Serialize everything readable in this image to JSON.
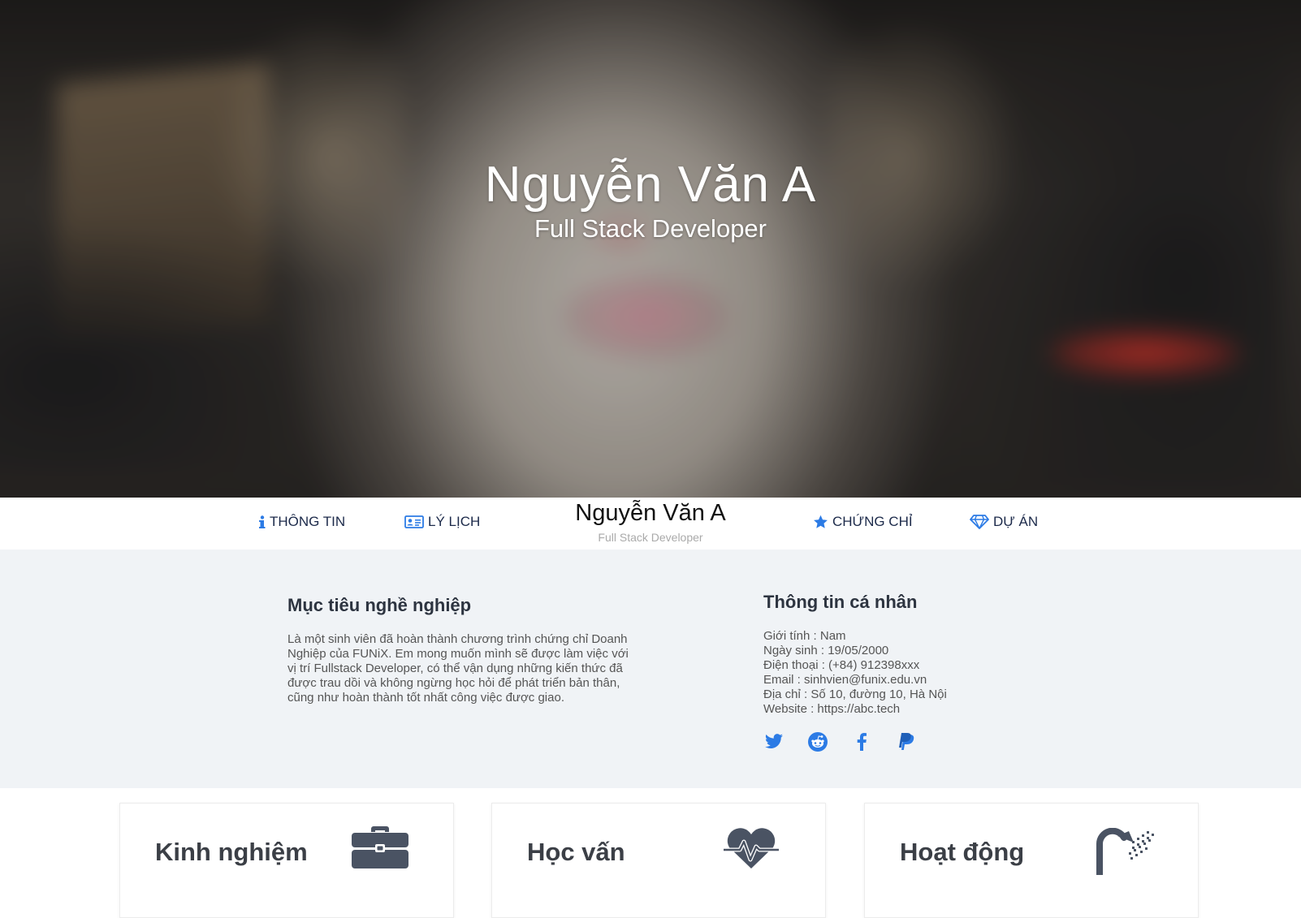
{
  "hero": {
    "name": "Nguyễn Văn A",
    "title": "Full Stack Developer"
  },
  "nav": {
    "brand_name": "Nguyễn Văn A",
    "brand_subtitle": "Full Stack Developer",
    "items": [
      {
        "label": "THÔNG TIN",
        "icon": "info-icon"
      },
      {
        "label": "LÝ LỊCH",
        "icon": "id-card-icon"
      },
      {
        "label": "CHỨNG CHỈ",
        "icon": "star-icon"
      },
      {
        "label": "DỰ ÁN",
        "icon": "diamond-icon"
      }
    ]
  },
  "about": {
    "objective_heading": "Mục tiêu nghề nghiệp",
    "objective_text": "Là một sinh viên đã hoàn thành chương trình chứng chỉ Doanh Nghiệp của FUNiX. Em mong muốn mình sẽ được làm việc với vị trí Fullstack Developer, có thể vận dụng những kiến thức đã được trau dồi và không ngừng học hỏi để phát triển bản thân, cũng như hoàn thành tốt nhất công việc được giao.",
    "personal_heading": "Thông tin cá nhân",
    "personal_lines": [
      "Giới tính : Nam",
      "Ngày sinh : 19/05/2000",
      "Điện thoại : (+84) 912398xxx",
      "Email : sinhvien@funix.edu.vn",
      "Địa chỉ : Số 10, đường 10, Hà Nội",
      "Website : https://abc.tech"
    ],
    "socials": [
      "twitter-icon",
      "reddit-icon",
      "facebook-icon",
      "paypal-icon"
    ]
  },
  "cards": [
    {
      "title": "Kinh nghiệm",
      "icon": "briefcase-icon"
    },
    {
      "title": "Học vấn",
      "icon": "heartbeat-icon"
    },
    {
      "title": "Hoạt động",
      "icon": "shower-icon"
    }
  ],
  "colors": {
    "accent": "#2c7be5",
    "about_bg": "#f0f3f6",
    "heading": "#2d3440"
  }
}
